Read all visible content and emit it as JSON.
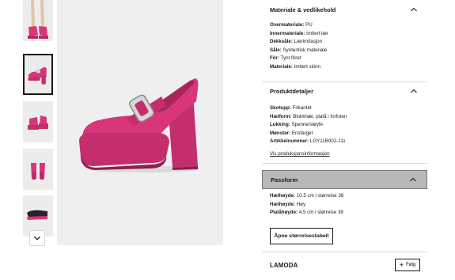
{
  "thumbnails": [
    {
      "view": "model-on-feet",
      "active": false
    },
    {
      "view": "side",
      "active": true
    },
    {
      "view": "front-angle",
      "active": false
    },
    {
      "view": "back",
      "active": false
    },
    {
      "view": "sole",
      "active": false
    }
  ],
  "thumbnail_scroll_icon": "chevron-down-icon",
  "product_image": {
    "view": "side",
    "color": "#d8357a"
  },
  "sections": {
    "material": {
      "title": "Materiale & vedlikehold",
      "rows": [
        {
          "label": "Overmateriale:",
          "value": "PU"
        },
        {
          "label": "Innermateriale:",
          "value": "Imitert lær"
        },
        {
          "label": "Dekksåle:",
          "value": "Lærimitasjon"
        },
        {
          "label": "Såle:",
          "value": "Syntentisk materiale"
        },
        {
          "label": "Fôr:",
          "value": "Tynt fôret"
        },
        {
          "label": "Materiale:",
          "value": "Imitert skinn"
        }
      ]
    },
    "details": {
      "title": "Produktdetaljer",
      "rows": [
        {
          "label": "Skotupp:",
          "value": "Firkantet"
        },
        {
          "label": "Hælform:",
          "value": "Blokkhæl, platå i forfoten"
        },
        {
          "label": "Lukking:",
          "value": "Spenne/sløyfe"
        },
        {
          "label": "Mønster:",
          "value": "Ensfarget"
        },
        {
          "label": "Artikkelnummer:",
          "value": "LGY11B002-J11"
        }
      ],
      "link": "Vis produksjonsinformasjon"
    },
    "fit": {
      "title": "Passform",
      "rows": [
        {
          "label": "Hælhøyde:",
          "value": "10.5 cm i størrelse 38"
        },
        {
          "label": "Hælhøyde:",
          "value": "Høy"
        },
        {
          "label": "Platåhøyde:",
          "value": "4.5 cm i størrelse 38"
        }
      ],
      "button": "Åpne størrelsestabell"
    }
  },
  "brand": {
    "name": "LAMODA",
    "follow_label": "Følg"
  },
  "colors": {
    "accent_shoe": "#d8357a",
    "highlight_bg": "#b8b8b8"
  }
}
